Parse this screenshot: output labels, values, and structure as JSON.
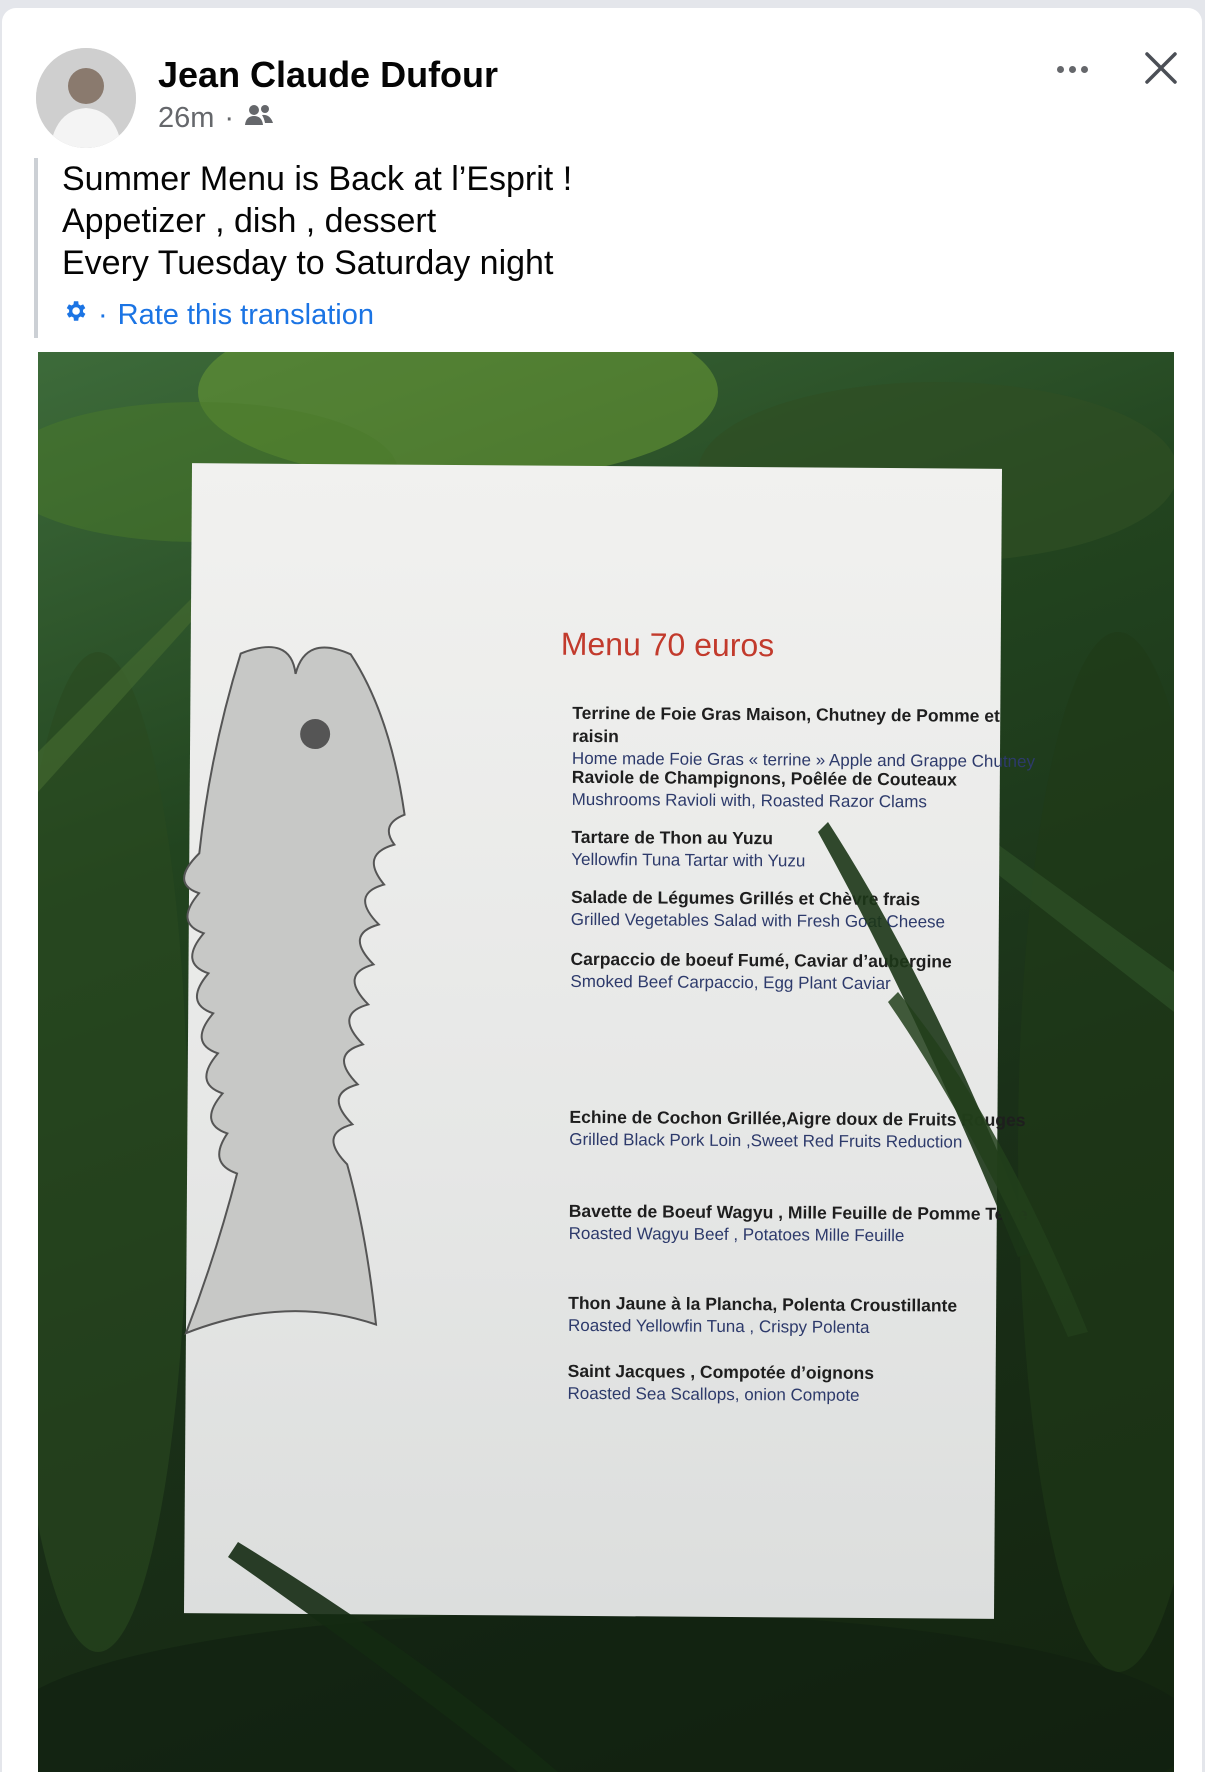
{
  "post": {
    "author": "Jean Claude Dufour",
    "time": "26m",
    "separator": "·",
    "audience_icon": "friends-icon",
    "more_icon": "more-options-icon",
    "close_icon": "close-icon",
    "text_lines": [
      "Summer Menu is Back at l’Esprit !",
      "Appetizer , dish , dessert",
      "Every Tuesday to Saturday night"
    ],
    "translation_icon": "gear-icon",
    "translation_separator": "·",
    "translation_link": "Rate this translation"
  },
  "menu": {
    "title": "Menu 70 euros",
    "starters": [
      {
        "fr": "Terrine de Foie Gras Maison, Chutney de Pomme et raisin",
        "en": "Home made Foie Gras « terrine » Apple and Grappe  Chutney"
      },
      {
        "fr": "Raviole de Champignons, Poêlée de Couteaux",
        "en": "Mushrooms Ravioli with, Roasted Razor Clams"
      },
      {
        "fr": "Tartare de Thon au Yuzu",
        "en": "Yellowfin Tuna Tartar with Yuzu"
      },
      {
        "fr": "Salade de Légumes Grillés et Chèvre frais",
        "en": "Grilled Vegetables Salad with Fresh Goat Cheese"
      },
      {
        "fr": "Carpaccio de boeuf Fumé, Caviar d’aubergine",
        "en": "Smoked Beef Carpaccio, Egg Plant Caviar"
      }
    ],
    "mains": [
      {
        "fr": "Echine de Cochon Grillée,Aigre doux de Fruits Rouges",
        "en": "Grilled Black Pork Loin ,Sweet  Red Fruits Reduction"
      },
      {
        "fr": "Bavette de Boeuf Wagyu , Mille Feuille de  Pomme Terre",
        "en": "Roasted Wagyu Beef ,  Potatoes Mille Feuille"
      },
      {
        "fr": "Thon Jaune  à la Plancha, Polenta Croustillante",
        "en": "Roasted Yellowfin Tuna , Crispy Polenta"
      },
      {
        "fr": "Saint Jacques , Compotée d’oignons",
        "en": "Roasted Sea Scallops, onion Compote"
      }
    ]
  },
  "colors": {
    "author": "#050505",
    "meta": "#65676b",
    "link": "#1b74e4",
    "menu_title": "#c23a2c"
  }
}
